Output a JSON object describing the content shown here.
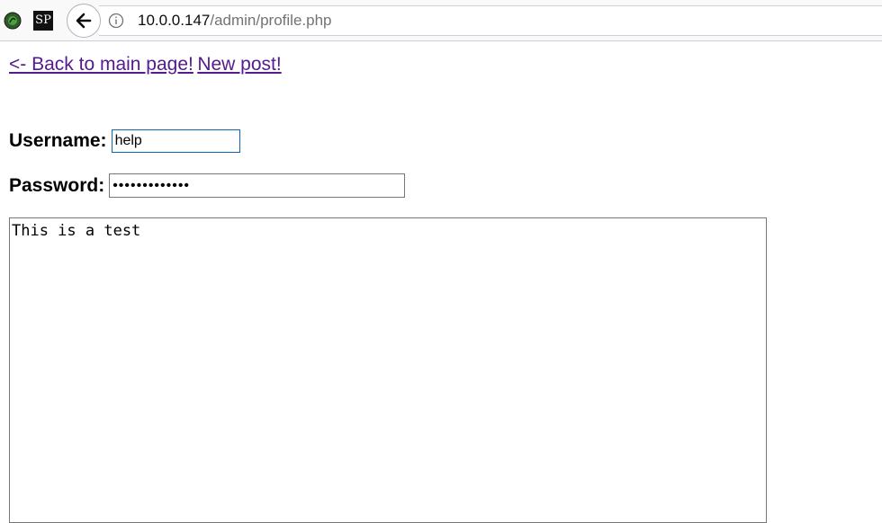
{
  "browser": {
    "url_host": "10.0.0.147",
    "url_path": "/admin/profile.php",
    "extension_2_label": "SP"
  },
  "nav": {
    "back_link": "<- Back to main page!",
    "new_post_link": "New post!"
  },
  "form": {
    "username_label": "Username:",
    "username_value": "help",
    "password_label": "Password:",
    "password_value": "•••••••••••••",
    "post_text": "This is a test"
  },
  "colors": {
    "visited_link": "#551a8b",
    "focus_border": "#0b66b6",
    "toolbar_bg": "#f9f9fa"
  },
  "icons": [
    "extension-green-icon",
    "extension-sp-icon",
    "back-arrow-icon",
    "info-icon"
  ]
}
